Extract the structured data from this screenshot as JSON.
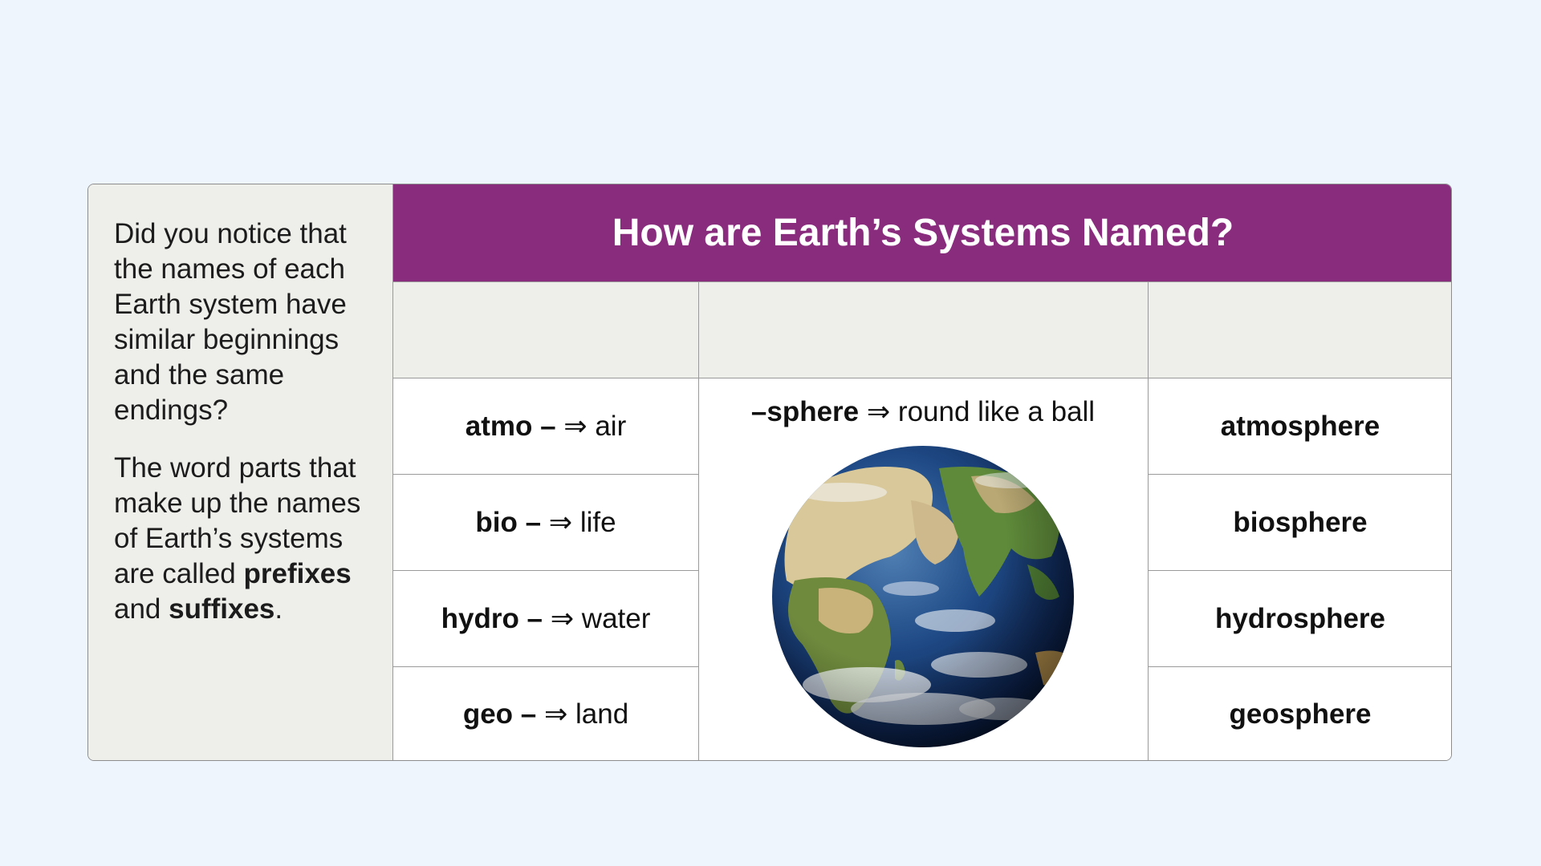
{
  "side_panel": {
    "paragraph1": "Did you notice that the names of each Earth system have similar beginnings and the same endings?",
    "p2_before": "The word parts that make up the names of Earth’s systems are called ",
    "p2_prefixes": "prefixes",
    "p2_and": " and ",
    "p2_suffixes": "suffixes",
    "p2_end": "."
  },
  "title": "How are Earth’s Systems Named?",
  "prefixes": [
    {
      "part": "atmo –",
      "meaning": " ⇒ air"
    },
    {
      "part": "bio –",
      "meaning": " ⇒ life"
    },
    {
      "part": "hydro –",
      "meaning": " ⇒ water"
    },
    {
      "part": "geo –",
      "meaning": " ⇒ land"
    }
  ],
  "suffix": {
    "part": "–sphere",
    "meaning": " ⇒ round like a ball"
  },
  "words": [
    "atmosphere",
    "biosphere",
    "hydrosphere",
    "geosphere"
  ]
}
